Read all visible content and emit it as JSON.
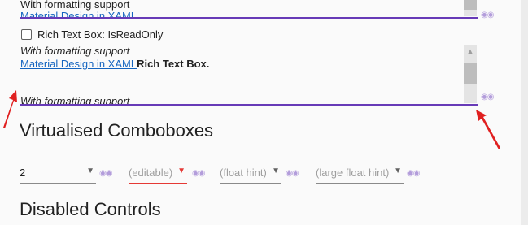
{
  "rich_text_top": {
    "line1": "With formatting support",
    "line2_partial": "Material Design in XAML"
  },
  "readonly_section": {
    "checkbox_label": "Rich Text Box: IsReadOnly",
    "checked": false,
    "line1": "With formatting support",
    "link_text": "Material Design in XAML",
    "bold_text": "Rich Text Box.",
    "line_bottom_partial": "With formatting support"
  },
  "icons": {
    "peek": "eye-icon",
    "scroll_up": "chevron-up-icon",
    "scroll_down": "chevron-down-icon",
    "dropdown": "caret-down-icon"
  },
  "virtualised": {
    "heading": "Virtualised Comboboxes",
    "combo1_value": "2",
    "combo2_hint": "(editable)",
    "combo3_hint": "(float hint)",
    "combo4_hint": "(large float hint)"
  },
  "disabled": {
    "heading": "Disabled Controls"
  },
  "colors": {
    "accent": "#673ab7",
    "error": "#e53935",
    "link": "#1565c0",
    "annotation_arrow": "#e02020"
  }
}
